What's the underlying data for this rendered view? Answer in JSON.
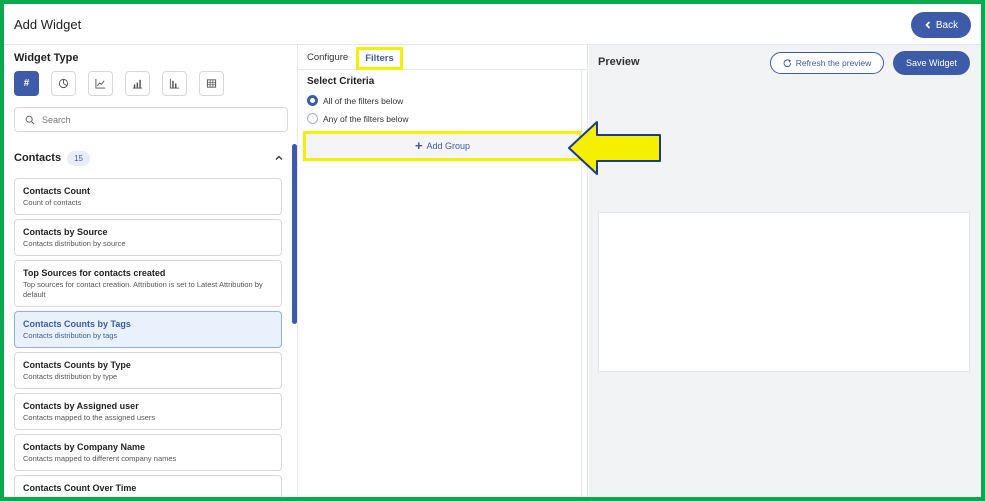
{
  "header": {
    "title": "Add Widget",
    "back_label": "Back"
  },
  "widget_type": {
    "title": "Widget Type",
    "active_label": "#",
    "icons": [
      "number-icon",
      "pie-chart-icon",
      "line-chart-icon",
      "bar-chart-icon",
      "column-chart-icon",
      "table-icon"
    ]
  },
  "search": {
    "placeholder": "Search"
  },
  "contacts": {
    "title": "Contacts",
    "count": "15",
    "items": [
      {
        "title": "Contacts Count",
        "desc": "Count of contacts"
      },
      {
        "title": "Contacts by Source",
        "desc": "Contacts distribution by source"
      },
      {
        "title": "Top Sources for contacts created",
        "desc": "Top sources for contact creation. Attribution is set to Latest Attribution by default"
      },
      {
        "title": "Contacts Counts by Tags",
        "desc": "Contacts distribution by tags"
      },
      {
        "title": "Contacts Counts by Type",
        "desc": "Contacts distribution by type"
      },
      {
        "title": "Contacts by Assigned user",
        "desc": "Contacts mapped to the assigned users"
      },
      {
        "title": "Contacts by Company Name",
        "desc": "Contacts mapped to different company names"
      },
      {
        "title": "Contacts Count Over Time",
        "desc": ""
      }
    ]
  },
  "tabs": {
    "configure": "Configure",
    "filters": "Filters"
  },
  "criteria": {
    "title": "Select Criteria",
    "option_all": "All of the filters below",
    "option_any": "Any of the filters below",
    "add_group": "Add Group"
  },
  "preview": {
    "title": "Preview",
    "refresh_label": "Refresh the preview",
    "save_label": "Save Widget"
  },
  "colors": {
    "accent": "#3e5ba9",
    "highlight": "#f5f000",
    "frame": "#0aa84f"
  }
}
